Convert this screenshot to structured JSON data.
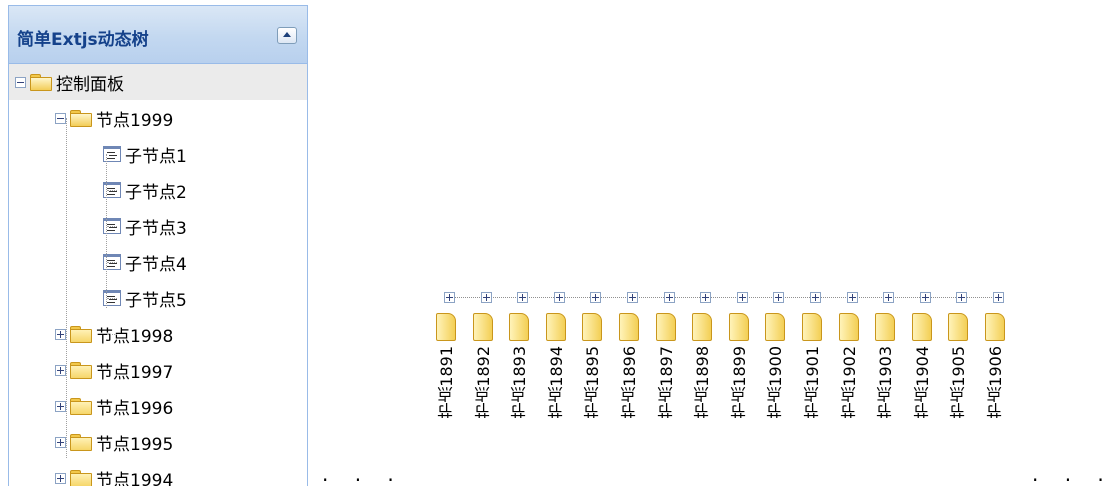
{
  "panel": {
    "title": "简单Extjs动态树"
  },
  "tree": {
    "root": "控制面板",
    "node_expanded": "节点1999",
    "children": [
      "子节点1",
      "子节点2",
      "子节点3",
      "子节点4",
      "子节点5"
    ],
    "collapsed_nodes": [
      "节点1998",
      "节点1997",
      "节点1996",
      "节点1995",
      "节点1994"
    ]
  },
  "horizontal_nodes": [
    "节点1891",
    "节点1892",
    "节点1893",
    "节点1894",
    "节点1895",
    "节点1896",
    "节点1897",
    "节点1898",
    "节点1899",
    "节点1900",
    "节点1901",
    "节点1902",
    "节点1903",
    "节点1904",
    "节点1905",
    "节点1906"
  ],
  "ellipsis": ". . .",
  "colors": {
    "header_title": "#15428b",
    "panel_border": "#99bbe8",
    "folder": "#f3cf55"
  }
}
